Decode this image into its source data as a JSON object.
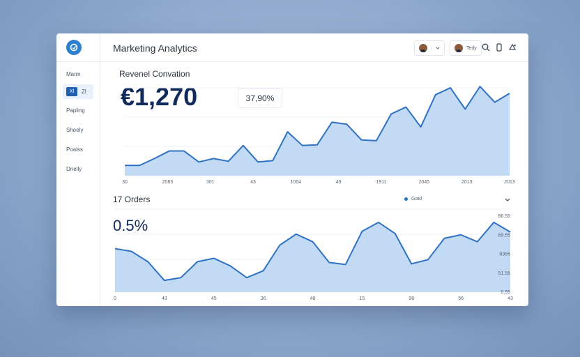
{
  "header": {
    "title": "Marketing Analytics",
    "user1_label": "",
    "user2_label": "Tedy"
  },
  "sidebar": {
    "items": [
      {
        "label": "Marm"
      },
      {
        "chip": "Xl",
        "label": "Zl"
      },
      {
        "label": "Papling"
      },
      {
        "label": "Sheely"
      },
      {
        "label": "Poalss"
      },
      {
        "label": "Dnelly"
      }
    ]
  },
  "revenue": {
    "title": "Revenel Convation",
    "value": "€1,270",
    "percent": "37,90%"
  },
  "orders": {
    "title": "17 Orders",
    "value": "0.5%",
    "legend": "Gatd"
  },
  "colors": {
    "line": "#2d72c4",
    "fill": "#bcd6f4",
    "brand": "#2d7fd0",
    "dark_text": "#102a5c"
  },
  "chart_data": [
    {
      "type": "area",
      "title": "Revenel Convation",
      "x_tick_labels": [
        "30",
        "2083",
        "301",
        "43",
        "1004",
        "49",
        "1911",
        "2045",
        "2013",
        "2013"
      ],
      "values": [
        15,
        15,
        25,
        36,
        36,
        20,
        25,
        21,
        44,
        20,
        22,
        64,
        44,
        45,
        78,
        75,
        52,
        51,
        90,
        100,
        71,
        118,
        128,
        97,
        130,
        107,
        120
      ],
      "ylim": [
        0,
        130
      ]
    },
    {
      "type": "area",
      "title": "17 Orders",
      "series_name": "Gatd",
      "x_tick_labels": [
        "0",
        "43",
        "45",
        "36",
        "48",
        "15",
        "98",
        "56",
        "43"
      ],
      "y_tick_labels": [
        "86.55",
        "69.55",
        "8365",
        "51.55",
        "0.55"
      ],
      "values": [
        63,
        59,
        44,
        17,
        21,
        44,
        49,
        38,
        21,
        31,
        68,
        84,
        73,
        43,
        40,
        88,
        101,
        85,
        41,
        47,
        78,
        83,
        73,
        101,
        87
      ],
      "ylim": [
        0,
        110
      ]
    }
  ]
}
